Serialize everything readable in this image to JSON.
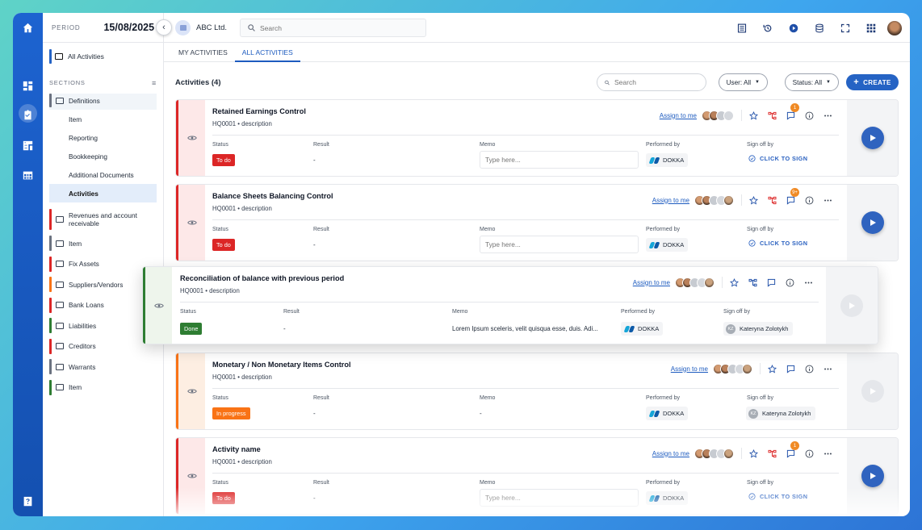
{
  "rail": {
    "icons": [
      "home-icon",
      "dashboard-icon",
      "clipboard-check-icon",
      "checklist-icon",
      "table-icon",
      "help-icon"
    ]
  },
  "sidebar": {
    "period_label": "PERIOD",
    "period_value": "15/08/2025",
    "all_activities": "All Activities",
    "sections_label": "SECTIONS",
    "definitions": {
      "label": "Definitions",
      "color": "#6b7280",
      "items": [
        "Item",
        "Reporting",
        "Bookkeeping",
        "Additional Documents",
        "Activities"
      ]
    },
    "sections": [
      {
        "label": "Revenues and account receivable",
        "color": "#dc2626"
      },
      {
        "label": "Item",
        "color": "#6b7280"
      },
      {
        "label": "Fix Assets",
        "color": "#dc2626"
      },
      {
        "label": "Suppliers/Vendors",
        "color": "#f97316"
      },
      {
        "label": "Bank Loans",
        "color": "#dc2626"
      },
      {
        "label": "Liabilities",
        "color": "#2e7d32"
      },
      {
        "label": "Creditors",
        "color": "#dc2626"
      },
      {
        "label": "Warrants",
        "color": "#6b7280"
      },
      {
        "label": "Item",
        "color": "#2e7d32"
      }
    ]
  },
  "topbar": {
    "company": "ABC Ltd.",
    "search_placeholder": "Search"
  },
  "tabs": [
    "MY ACTIVITIES",
    "ALL ACTIVITIES"
  ],
  "toolbar": {
    "title": "Activities (4)",
    "search_placeholder": "Search",
    "user_filter": "User: All",
    "status_filter": "Status: All",
    "create": "CREATE"
  },
  "labels": {
    "status": "Status",
    "result": "Result",
    "memo": "Memo",
    "performed_by": "Performed by",
    "sign_off_by": "Sign off by",
    "assign": "Assign to me",
    "memo_placeholder": "Type here...",
    "click_to_sign": "CLICK TO SIGN",
    "performer": "DOKKA"
  },
  "cards": [
    {
      "title": "Retained Earnings Control",
      "code": "HQ0001",
      "desc": "description",
      "status": "To do",
      "result": "-",
      "badge": "1"
    },
    {
      "title": "Balance Sheets Balancing Control",
      "code": "HQ0001",
      "desc": "description",
      "status": "To do",
      "result": "-",
      "badge": "9+"
    },
    {
      "title": "Reconciliation of balance with previous period",
      "code": "HQ0001",
      "desc": "description",
      "status": "Done",
      "result": "-",
      "memo": "Lorem Ipsum sceleris, velit quisqua esse, duis. Adi...",
      "signer": "Kateryna Zolotykh",
      "signer_initials": "KZ"
    },
    {
      "title": "Monetary / Non Monetary Items Control",
      "code": "HQ0001",
      "desc": "description",
      "status": "In progress",
      "result": "-",
      "memo": "-",
      "signer": "Kateryna Zolotykh",
      "signer_initials": "KZ"
    },
    {
      "title": "Activity name",
      "code": "HQ0001",
      "desc": "description",
      "status": "To do",
      "result": "-",
      "badge": "1"
    }
  ],
  "colors": {
    "todo": "#dc2626",
    "done": "#2e7d32",
    "inprogress": "#f97316",
    "accent": "#2563c4"
  }
}
